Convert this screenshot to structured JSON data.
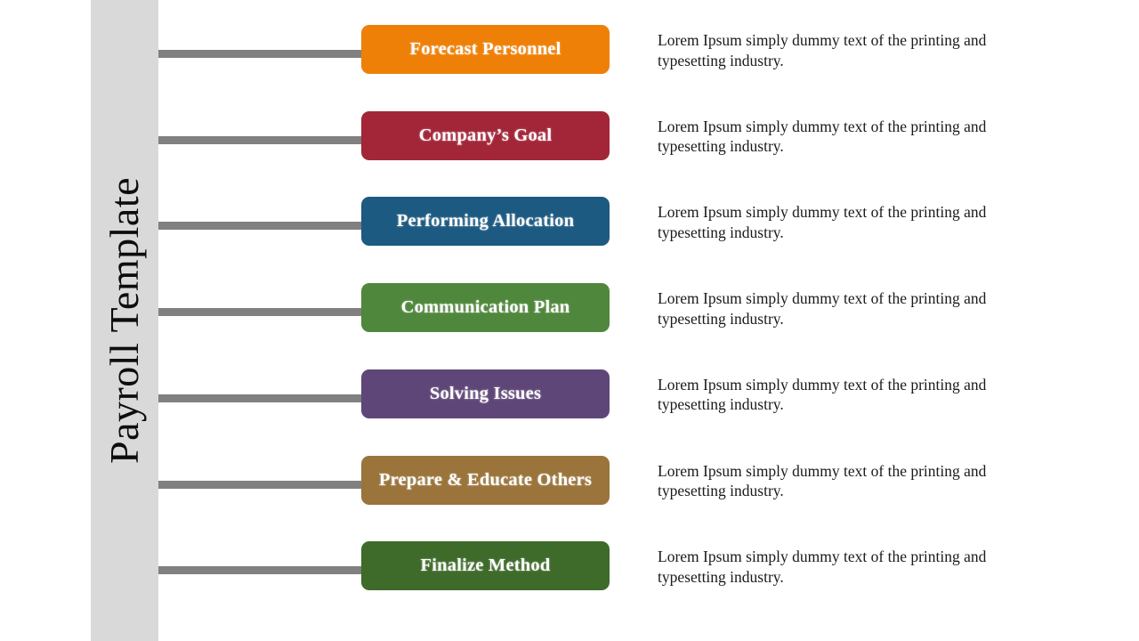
{
  "slide": {
    "title": "Payroll Template",
    "background_color": "#FFFFFF",
    "title_band_color": "#D9D9D9",
    "connector_color": "#808080"
  },
  "rows": [
    {
      "label": "Forecast Personnel",
      "color": "#EE8008",
      "description": "Lorem Ipsum simply dummy text of the printing and typesetting industry."
    },
    {
      "label": "Company’s Goal",
      "color": "#A32638",
      "description": "Lorem Ipsum simply dummy text of the printing and typesetting industry."
    },
    {
      "label": "Performing Allocation",
      "color": "#1D5A81",
      "description": "Lorem Ipsum simply dummy text of the printing and typesetting industry."
    },
    {
      "label": "Communication Plan",
      "color": "#4F873C",
      "description": "Lorem Ipsum simply dummy text of the printing and typesetting industry."
    },
    {
      "label": "Solving Issues",
      "color": "#5F4678",
      "description": "Lorem Ipsum simply dummy text of the printing and typesetting industry."
    },
    {
      "label": "Prepare & Educate Others",
      "color": "#9A743B",
      "description": "Lorem Ipsum simply dummy text of the printing and typesetting industry."
    },
    {
      "label": "Finalize Method",
      "color": "#3E6A2A",
      "description": "Lorem Ipsum simply dummy text of the printing and typesetting industry."
    }
  ]
}
